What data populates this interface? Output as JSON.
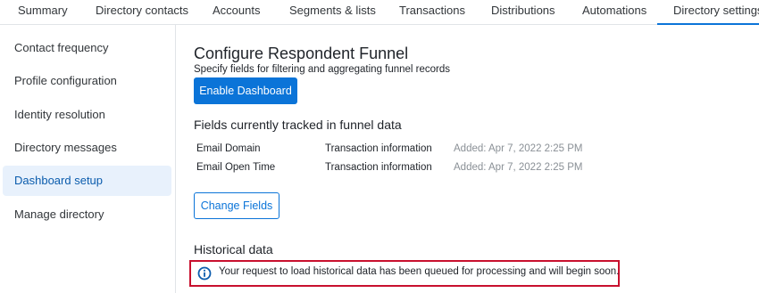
{
  "top_tabs": [
    "Summary",
    "Directory contacts",
    "Accounts",
    "Segments & lists",
    "Transactions",
    "Distributions",
    "Automations",
    "Directory settings"
  ],
  "active_tab": "Directory settings",
  "sidebar": {
    "items": [
      "Contact frequency",
      "Profile configuration",
      "Identity resolution",
      "Directory messages",
      "Dashboard setup",
      "Manage directory"
    ],
    "active": "Dashboard setup"
  },
  "main": {
    "title": "Configure Respondent Funnel",
    "subtitle": "Specify fields for filtering and aggregating funnel records",
    "enable_button": "Enable Dashboard",
    "fields_heading": "Fields currently tracked in funnel data",
    "fields": [
      {
        "name": "Email Domain",
        "source": "Transaction information",
        "added": "Added: Apr 7, 2022 2:25 PM"
      },
      {
        "name": "Email Open Time",
        "source": "Transaction information",
        "added": "Added: Apr 7, 2022 2:25 PM"
      }
    ],
    "change_button": "Change Fields",
    "historical_heading": "Historical data",
    "notice_text": "Your request to load historical data has been queued for processing and will begin soon.",
    "notice_icon": "info-icon"
  },
  "colors": {
    "accent": "#0b74d8",
    "highlight": "#c8102e",
    "active_bg": "#e8f1fc"
  }
}
